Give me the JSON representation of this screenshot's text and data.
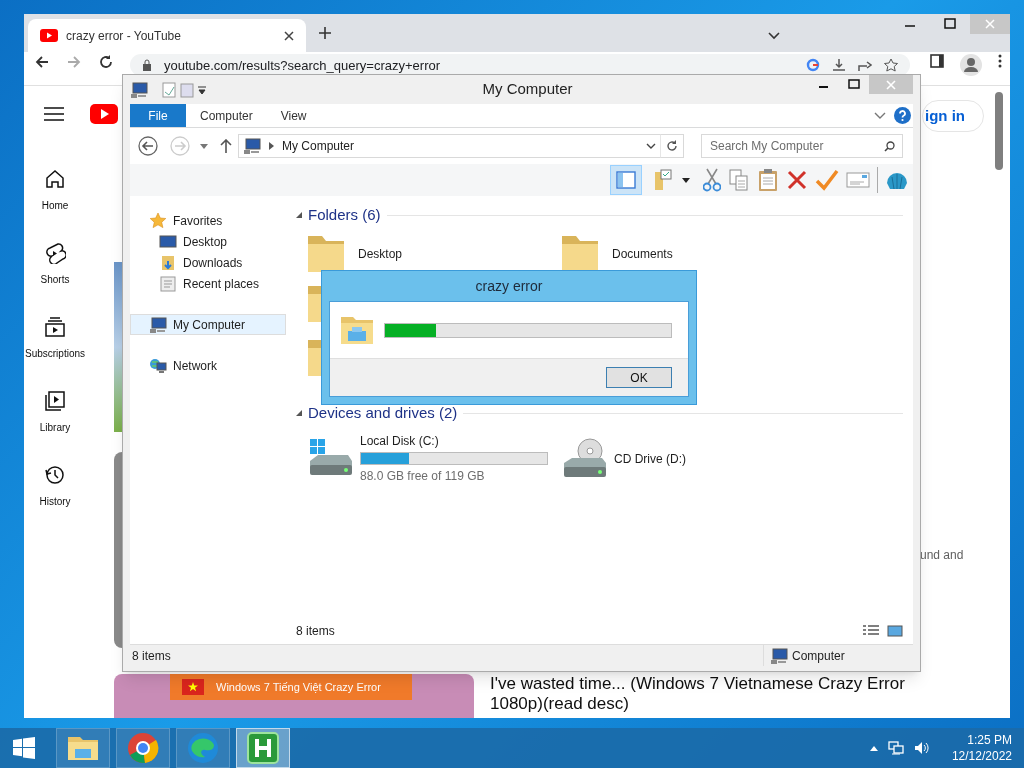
{
  "browser": {
    "tab": {
      "title": "crazy error - YouTube"
    },
    "url": "youtube.com/results?search_query=crazy+error"
  },
  "youtube": {
    "sidebar": [
      {
        "label": "Home"
      },
      {
        "label": "Shorts"
      },
      {
        "label": "Subscriptions"
      },
      {
        "label": "Library"
      },
      {
        "label": "History"
      }
    ],
    "sign_in": "ign in",
    "snippet": "und and",
    "video": {
      "banner": "Windows 7 Tiếng Việt Crazy Error",
      "title": "I've wasted time... (Windows 7 Vietnamese Crazy Error 1080p)(read desc)"
    }
  },
  "explorer": {
    "title": "My Computer",
    "ribbon_tabs": [
      {
        "label": "File",
        "selected": true
      },
      {
        "label": "Computer",
        "selected": false
      },
      {
        "label": "View",
        "selected": false
      }
    ],
    "breadcrumb": "My Computer",
    "search": {
      "placeholder": "Search My Computer"
    },
    "nav": [
      {
        "label": "Favorites",
        "selected": false,
        "children": [
          {
            "label": "Desktop",
            "selected": false
          },
          {
            "label": "Downloads",
            "selected": false
          },
          {
            "label": "Recent places",
            "selected": false
          }
        ]
      },
      {
        "label": "My Computer",
        "selected": true
      },
      {
        "label": "Network",
        "selected": false
      }
    ],
    "folders": {
      "title": "Folders (6)",
      "items": [
        {
          "label": "Desktop"
        },
        {
          "label": "Documents"
        }
      ]
    },
    "drives": {
      "title": "Devices and drives (2)",
      "items": [
        {
          "kind": "disk",
          "label": "Local Disk (C:)",
          "level": 0.26,
          "free": "88.0 GB free of 119 GB"
        },
        {
          "kind": "cd",
          "label": "CD Drive (D:)"
        }
      ]
    },
    "item_count": "8 items",
    "status": {
      "count": "8 items",
      "location": "Computer"
    }
  },
  "dialog": {
    "title": "crazy error",
    "level": 0.18,
    "button": "OK"
  },
  "taskbar": {
    "apps": [
      {
        "selected": false
      },
      {
        "selected": false
      },
      {
        "selected": false
      },
      {
        "selected": true
      }
    ],
    "time": "1:25 PM",
    "date": "12/12/2022"
  }
}
